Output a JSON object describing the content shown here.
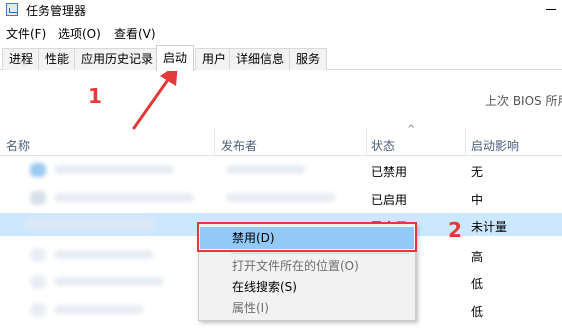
{
  "window": {
    "title": "任务管理器",
    "icon": "task-manager-icon"
  },
  "menubar": {
    "items": [
      "文件(F)",
      "选项(O)",
      "查看(V)"
    ]
  },
  "tabs": [
    "进程",
    "性能",
    "应用历史记录",
    "启动",
    "用户",
    "详细信息",
    "服务"
  ],
  "active_tab": "启动",
  "bios_label": "上次 BIOS 所用",
  "columns": {
    "name": "名称",
    "publisher": "发布者",
    "status": "状态",
    "impact": "启动影响"
  },
  "rows": [
    {
      "status": "已禁用",
      "impact": "无"
    },
    {
      "status": "已启用",
      "impact": "中"
    },
    {
      "status": "已启用",
      "impact": "未计量",
      "selected": true
    },
    {
      "status": "",
      "impact": "高"
    },
    {
      "status": "",
      "impact": "低"
    },
    {
      "status": "",
      "impact": "低"
    }
  ],
  "context_menu": {
    "items": [
      {
        "label": "禁用(D)",
        "state": "highlighted"
      },
      {
        "label": "打开文件所在的位置(O)",
        "state": "disabled"
      },
      {
        "label": "在线搜索(S)",
        "state": "enabled"
      },
      {
        "label": "属性(I)",
        "state": "disabled"
      }
    ]
  },
  "annotations": {
    "step1": "1",
    "step2": "2",
    "color": "#e23a3a"
  },
  "colors": {
    "selection": "#cce8ff",
    "menu_highlight": "#91c9f7",
    "header_text": "#4c607a"
  }
}
